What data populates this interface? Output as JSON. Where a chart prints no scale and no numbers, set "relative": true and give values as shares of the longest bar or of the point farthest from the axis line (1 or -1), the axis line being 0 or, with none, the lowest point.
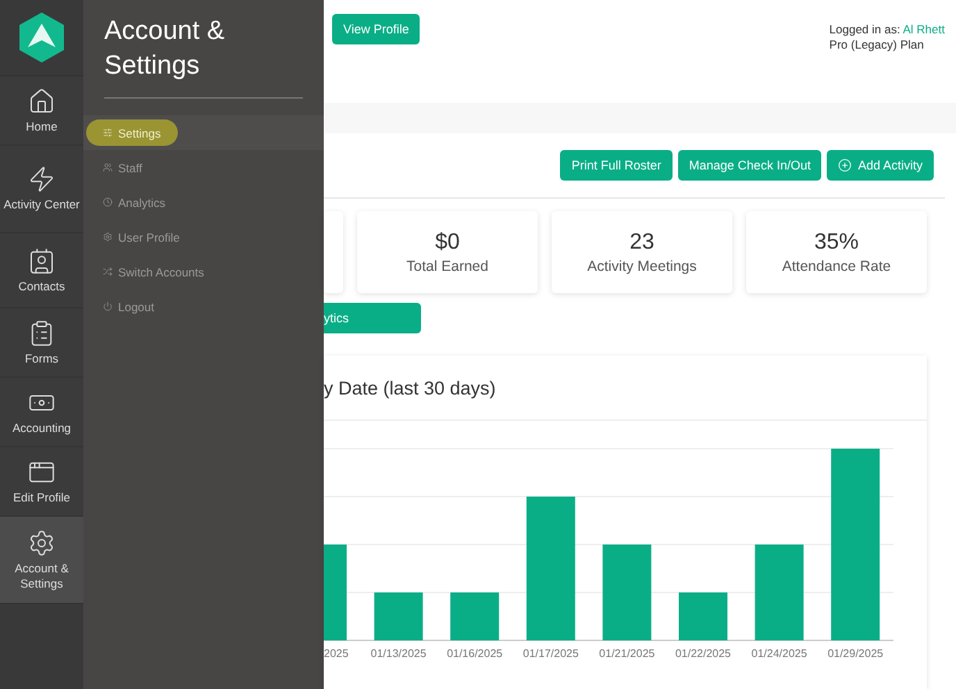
{
  "rail": {
    "items": [
      {
        "label": "Home",
        "selected": false
      },
      {
        "label": "Activity Center",
        "selected": false
      },
      {
        "label": "Contacts",
        "selected": false
      },
      {
        "label": "Forms",
        "selected": false
      },
      {
        "label": "Accounting",
        "selected": false
      },
      {
        "label": "Edit Profile",
        "selected": false
      },
      {
        "label": "Account & Settings",
        "selected": true
      }
    ]
  },
  "drawer": {
    "title": "Account & Settings",
    "items": [
      {
        "label": "Settings",
        "selected": true
      },
      {
        "label": "Staff",
        "selected": false
      },
      {
        "label": "Analytics",
        "selected": false
      },
      {
        "label": "User Profile",
        "selected": false
      },
      {
        "label": "Switch Accounts",
        "selected": false
      },
      {
        "label": "Logout",
        "selected": false
      }
    ]
  },
  "header": {
    "view_profile": "View Profile",
    "logged_in_label": "Logged in as:",
    "user": "Al Rhett",
    "plan": "Pro (Legacy) Plan"
  },
  "actions": [
    {
      "label": "Print Full Roster"
    },
    {
      "label": "Manage Check In/Out"
    },
    {
      "label": "Add Activity"
    }
  ],
  "stats": [
    {
      "value": "$0",
      "label": "Total Earned"
    },
    {
      "value": "23",
      "label": "Activity Meetings"
    },
    {
      "value": "35%",
      "label": "Attendance Rate"
    }
  ],
  "analytics_button": "ytics",
  "chart": {
    "title": "y Date (last 30 days)",
    "chart_data": {
      "type": "bar",
      "relative": true,
      "categories": [
        "2025",
        "01/13/2025",
        "01/16/2025",
        "01/17/2025",
        "01/21/2025",
        "01/22/2025",
        "01/24/2025",
        "01/29/2025"
      ],
      "series": [
        {
          "color": "#0aae86",
          "values": [
            0.5,
            0.25,
            0.25,
            0.75,
            0.5,
            0.25,
            0.5,
            1
          ]
        }
      ]
    }
  }
}
